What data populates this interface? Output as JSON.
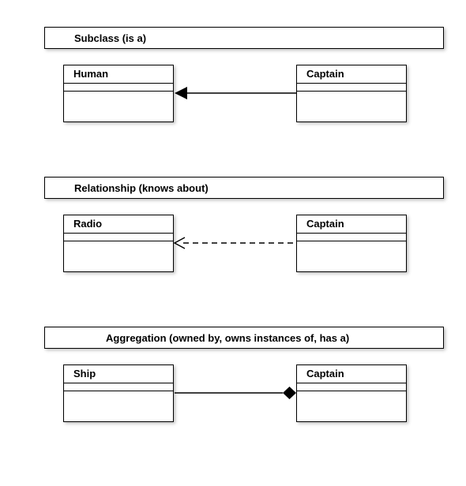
{
  "sections": [
    {
      "title": "Subclass (is a)",
      "left_class": "Human",
      "right_class": "Captain",
      "connector": "inheritance-solid-closed-arrow"
    },
    {
      "title": "Relationship (knows about)",
      "left_class": "Radio",
      "right_class": "Captain",
      "connector": "dependency-dashed-open-arrow"
    },
    {
      "title": "Aggregation (owned by, owns instances of, has a)",
      "left_class": "Ship",
      "right_class": "Captain",
      "connector": "aggregation-solid-diamond"
    }
  ]
}
